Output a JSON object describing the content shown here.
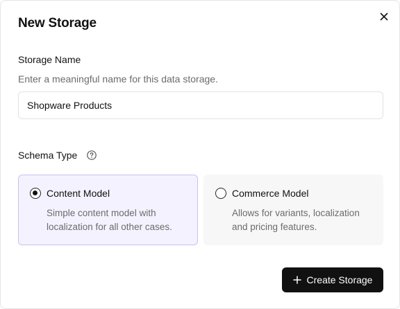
{
  "dialog": {
    "title": "New Storage",
    "close_icon": "close-icon"
  },
  "storage_name": {
    "label": "Storage Name",
    "help": "Enter a meaningful name for this data storage.",
    "value": "Shopware Products",
    "placeholder": ""
  },
  "schema_type": {
    "label": "Schema Type",
    "help_icon": "help-circle-icon",
    "options": [
      {
        "title": "Content Model",
        "description": "Simple content model with localization for all other cases.",
        "selected": true
      },
      {
        "title": "Commerce Model",
        "description": "Allows for variants, localization and pricing features.",
        "selected": false
      }
    ]
  },
  "actions": {
    "create_label": "Create Storage",
    "create_icon": "plus-icon"
  },
  "colors": {
    "primary_button": "#111111",
    "selected_bg": "#f4f2fe",
    "selected_border": "#c9c0f3",
    "muted_text": "#6b6b6b"
  }
}
